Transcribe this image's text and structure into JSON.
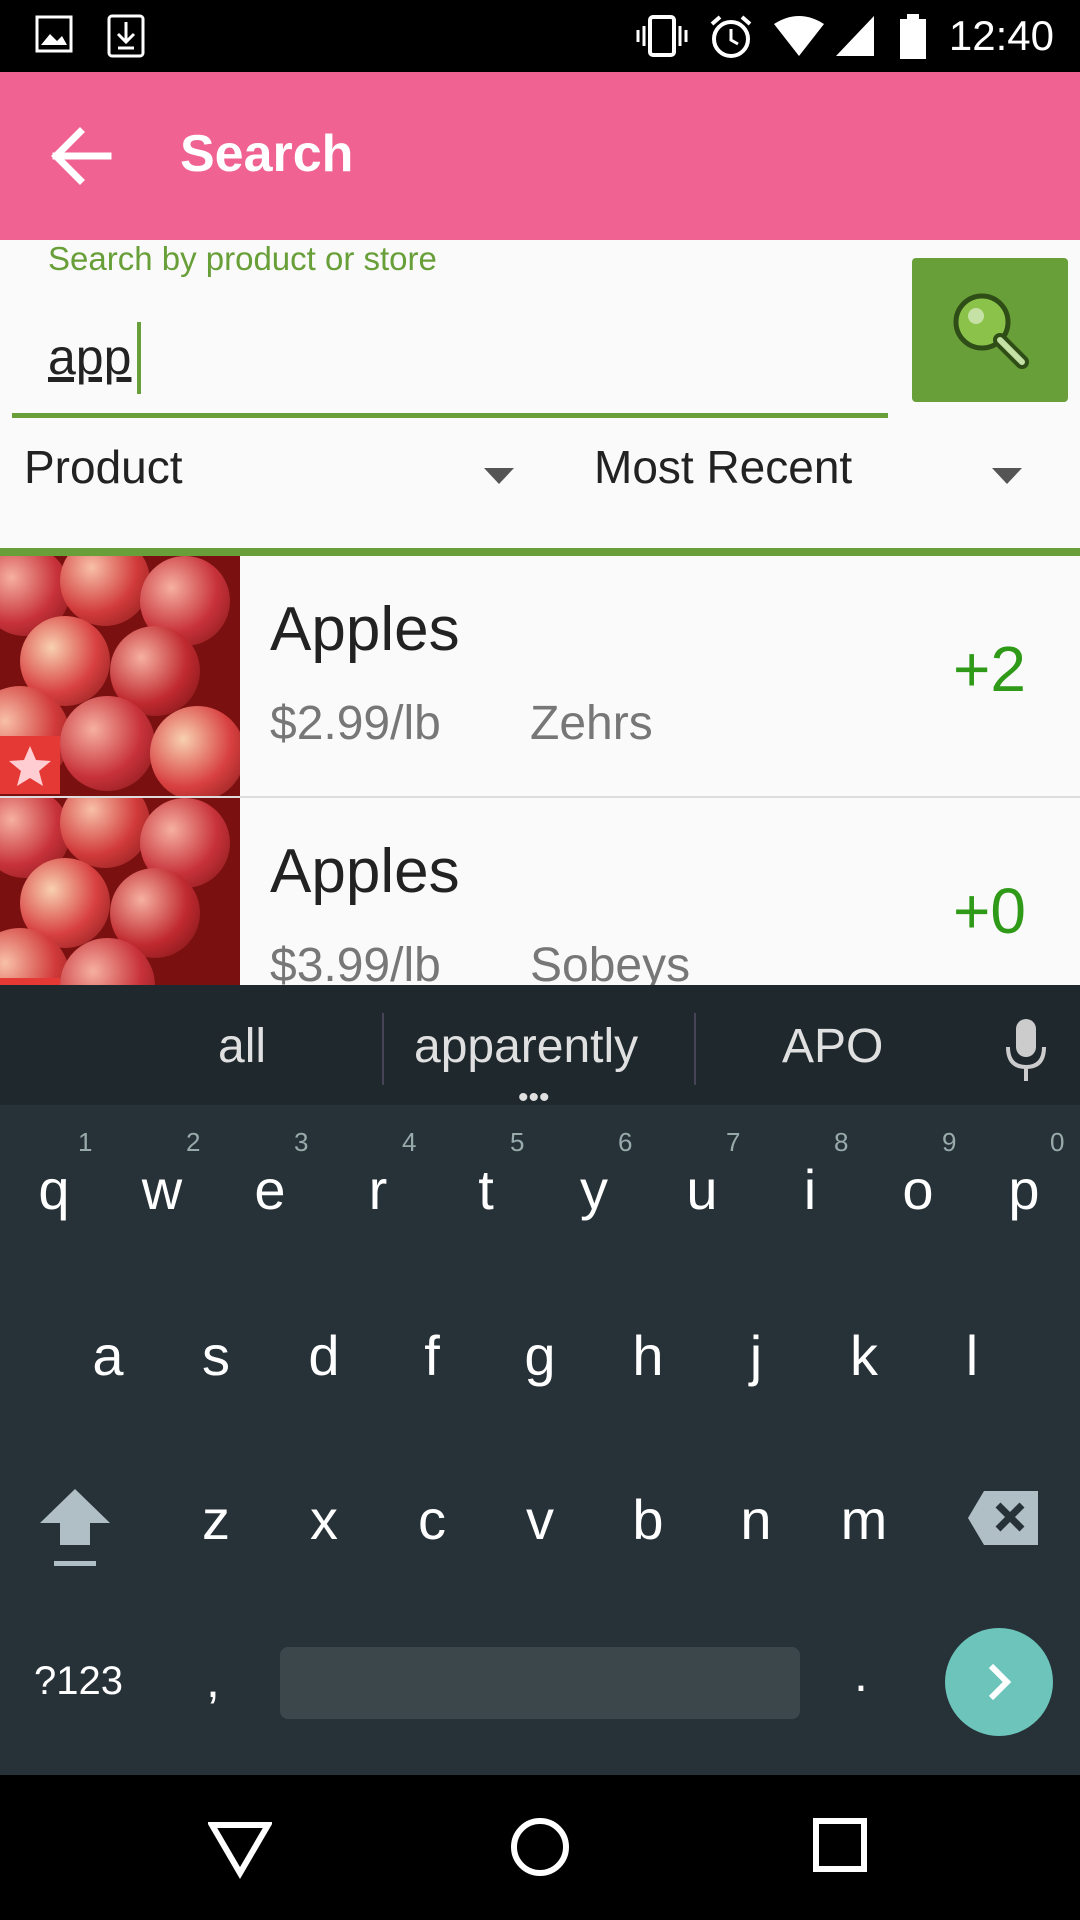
{
  "status_bar": {
    "time": "12:40",
    "icons": [
      "image-icon",
      "download-icon",
      "vibrate-icon",
      "alarm-icon",
      "wifi-icon",
      "signal-icon",
      "battery-icon"
    ]
  },
  "app_bar": {
    "title": "Search",
    "back_icon": "arrow-left-icon",
    "background": "#f06292"
  },
  "search": {
    "hint": "Search by product or store",
    "value": "app",
    "button_icon": "magnifier-icon",
    "accent": "#689f38"
  },
  "filters": {
    "type_selected": "Product",
    "sort_selected": "Most Recent"
  },
  "results": [
    {
      "name": "Apples",
      "price": "$2.99/lb",
      "store": "Zehrs",
      "score": "+2",
      "favorite": true
    },
    {
      "name": "Apples",
      "price": "$3.99/lb",
      "store": "Sobeys",
      "score": "+0",
      "favorite": true
    }
  ],
  "keyboard": {
    "suggestions": [
      "all",
      "apparently",
      "APO"
    ],
    "row1": [
      "q",
      "w",
      "e",
      "r",
      "t",
      "y",
      "u",
      "i",
      "o",
      "p"
    ],
    "row1_hints": [
      "1",
      "2",
      "3",
      "4",
      "5",
      "6",
      "7",
      "8",
      "9",
      "0"
    ],
    "row2": [
      "a",
      "s",
      "d",
      "f",
      "g",
      "h",
      "j",
      "k",
      "l"
    ],
    "row3": [
      "z",
      "x",
      "c",
      "v",
      "b",
      "n",
      "m"
    ],
    "symbols_key": "?123",
    "comma_key": ",",
    "period_key": ".",
    "enter_color": "#6cc4bb"
  },
  "nav_bar": {
    "icons": [
      "back-triangle-icon",
      "home-circle-icon",
      "recents-square-icon"
    ]
  }
}
